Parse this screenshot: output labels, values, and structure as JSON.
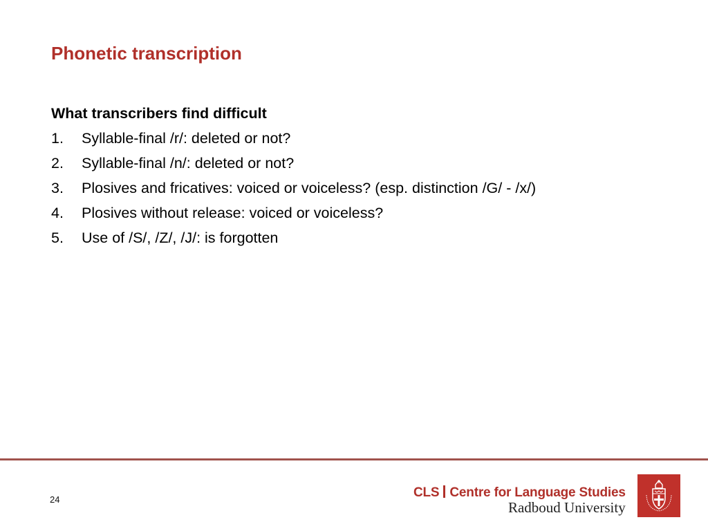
{
  "slide": {
    "title": "Phonetic transcription",
    "heading": "What transcribers find difficult",
    "items": [
      {
        "number": "1.",
        "text": "Syllable-final /r/: deleted or not?"
      },
      {
        "number": "2.",
        "text": "Syllable-final /n/: deleted or not?"
      },
      {
        "number": "3.",
        "text": "Plosives and fricatives: voiced or voiceless? (esp. distinction /G/ - /x/)"
      },
      {
        "number": "4.",
        "text": "Plosives without release: voiced or voiceless?"
      },
      {
        "number": "5.",
        "text": "Use of /S/, /Z/, /J/: is forgotten"
      }
    ],
    "page_number": "24"
  },
  "footer": {
    "cls_abbrev": "CLS",
    "cls_name": "Centre for Language Studies",
    "university": "Radboud University",
    "logo_icon": "radboud-crest-icon"
  },
  "colors": {
    "accent": "#b0302a",
    "divider": "#a0524c",
    "crest_background": "#c0312b"
  }
}
